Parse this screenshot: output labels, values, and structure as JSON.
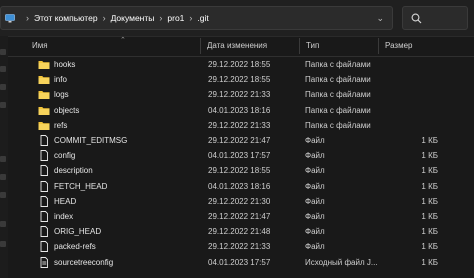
{
  "address_bar": {
    "path": [
      "Этот компьютер",
      "Документы",
      "pro1",
      ".git"
    ]
  },
  "columns": {
    "name": "Имя",
    "date": "Дата изменения",
    "type": "Тип",
    "size": "Размер"
  },
  "files": [
    {
      "name": "hooks",
      "date": "29.12.2022 18:55",
      "type": "Папка с файлами",
      "size": "",
      "kind": "folder"
    },
    {
      "name": "info",
      "date": "29.12.2022 18:55",
      "type": "Папка с файлами",
      "size": "",
      "kind": "folder"
    },
    {
      "name": "logs",
      "date": "29.12.2022 21:33",
      "type": "Папка с файлами",
      "size": "",
      "kind": "folder"
    },
    {
      "name": "objects",
      "date": "04.01.2023 18:16",
      "type": "Папка с файлами",
      "size": "",
      "kind": "folder"
    },
    {
      "name": "refs",
      "date": "29.12.2022 21:33",
      "type": "Папка с файлами",
      "size": "",
      "kind": "folder"
    },
    {
      "name": "COMMIT_EDITMSG",
      "date": "29.12.2022 21:47",
      "type": "Файл",
      "size": "1 КБ",
      "kind": "file"
    },
    {
      "name": "config",
      "date": "04.01.2023 17:57",
      "type": "Файл",
      "size": "1 КБ",
      "kind": "file"
    },
    {
      "name": "description",
      "date": "29.12.2022 18:55",
      "type": "Файл",
      "size": "1 КБ",
      "kind": "file"
    },
    {
      "name": "FETCH_HEAD",
      "date": "04.01.2023 18:16",
      "type": "Файл",
      "size": "1 КБ",
      "kind": "file"
    },
    {
      "name": "HEAD",
      "date": "29.12.2022 21:30",
      "type": "Файл",
      "size": "1 КБ",
      "kind": "file"
    },
    {
      "name": "index",
      "date": "29.12.2022 21:47",
      "type": "Файл",
      "size": "1 КБ",
      "kind": "file"
    },
    {
      "name": "ORIG_HEAD",
      "date": "29.12.2022 21:48",
      "type": "Файл",
      "size": "1 КБ",
      "kind": "file"
    },
    {
      "name": "packed-refs",
      "date": "29.12.2022 21:33",
      "type": "Файл",
      "size": "1 КБ",
      "kind": "file"
    },
    {
      "name": "sourcetreeconfig",
      "date": "04.01.2023 17:57",
      "type": "Исходный файл J...",
      "size": "1 КБ",
      "kind": "file-special"
    }
  ],
  "colors": {
    "folder": "#f2c43a",
    "file": "#e8e8e8",
    "background": "#191919",
    "chrome": "#202020"
  },
  "icons": {
    "computer": "computer-icon",
    "chevron": "chevron-right-icon",
    "search": "search-icon",
    "folder": "folder-icon",
    "file": "file-icon"
  }
}
